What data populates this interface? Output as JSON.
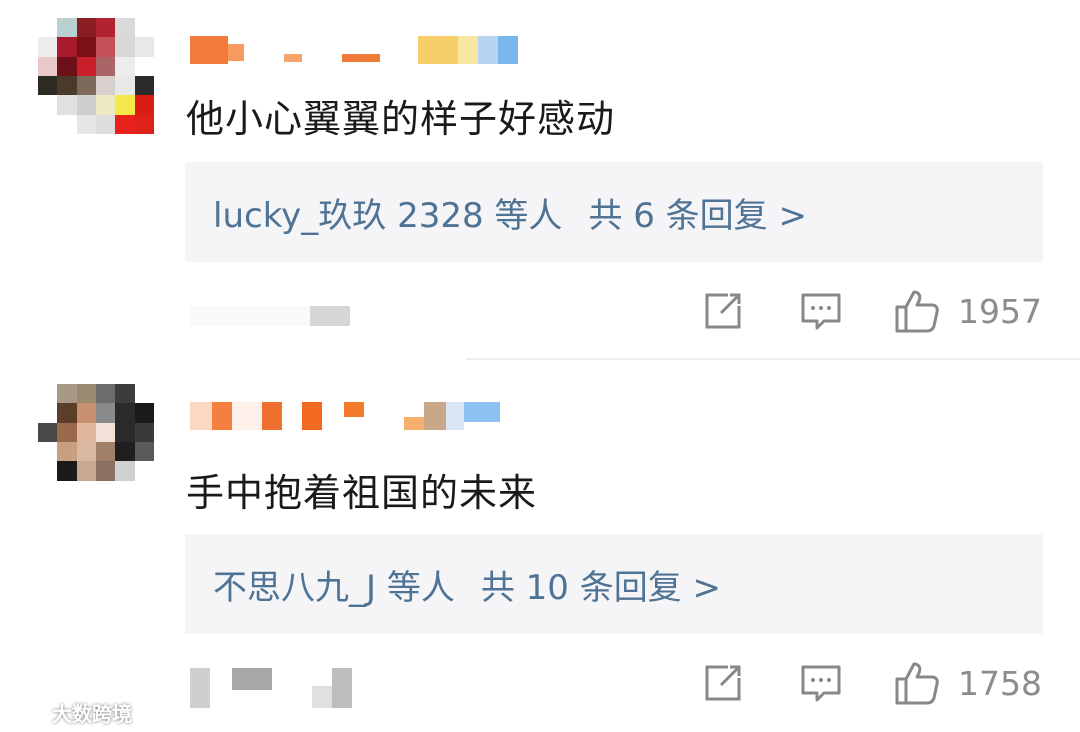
{
  "comments": [
    {
      "text": "他小心翼翼的样子好感动",
      "replies_who": "lucky_玖玖 2328 等人",
      "replies_total": "共 6 条回复 >",
      "likes": "1957"
    },
    {
      "text": "手中抱着祖国的未来",
      "replies_who": "不思八九_J 等人",
      "replies_total": "共 10 条回复 >",
      "likes": "1758"
    }
  ],
  "icons": [
    "share-icon",
    "comment-icon",
    "like-icon"
  ],
  "colors": {
    "link": "#4e7395",
    "reply_bg": "#f5f5f7",
    "text": "#1a1a1a",
    "muted": "#8c8c8c"
  },
  "watermark": "大数跨境"
}
